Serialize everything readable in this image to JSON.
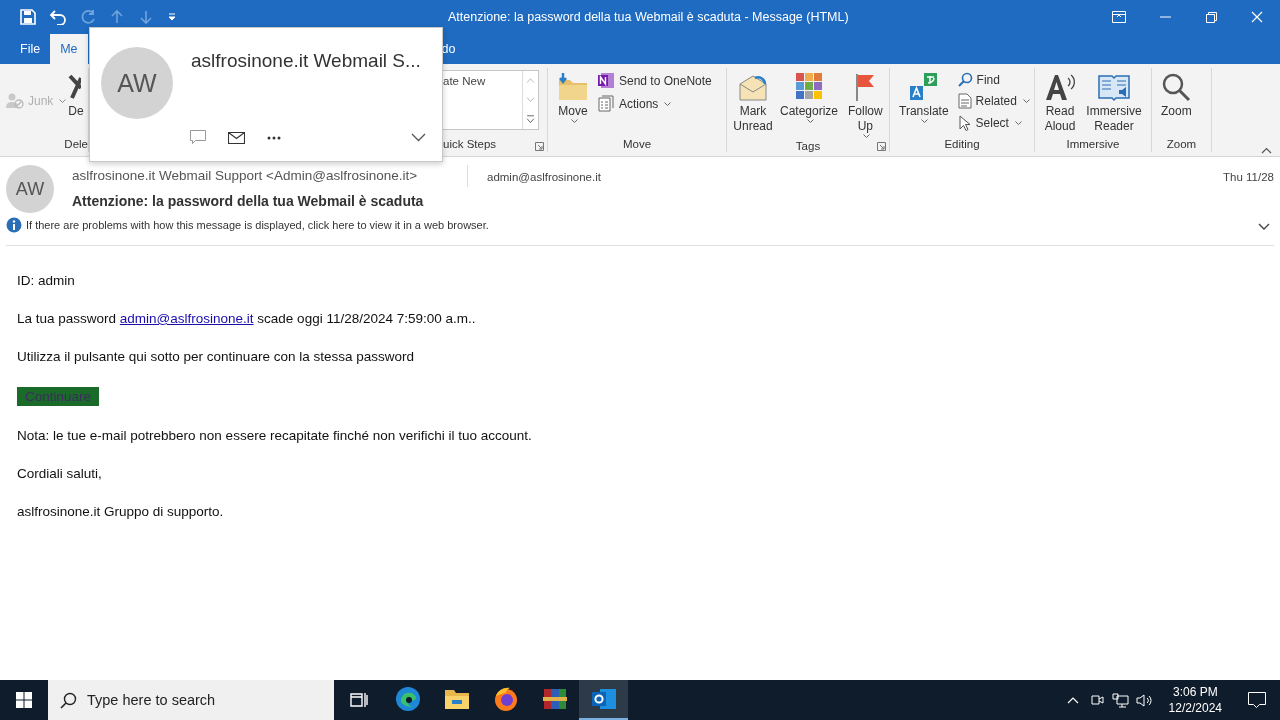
{
  "window": {
    "title": "Attenzione: la password della tua Webmail è scaduta  -  Message (HTML)"
  },
  "tabs": [
    {
      "label": "File",
      "selected": false
    },
    {
      "label": "Me",
      "selected": true
    },
    {
      "label": "do",
      "selected": false
    }
  ],
  "ribbon": {
    "groups": [
      {
        "label": "Dele",
        "items": [
          {
            "label": "Junk",
            "kind": "small",
            "disabled": true,
            "has_menu": true
          },
          {
            "label": "De",
            "kind": "large",
            "disabled": false,
            "has_menu": false
          }
        ]
      },
      {
        "label": "uick Steps",
        "launcher": true,
        "items": [
          {
            "label": "ate New",
            "kind": "gallery",
            "disabled": false,
            "has_menu": false
          }
        ]
      },
      {
        "label": "Move",
        "launcher": false,
        "items": [
          {
            "label": "Move",
            "kind": "large",
            "disabled": false,
            "has_menu": true
          },
          {
            "label": "Send to OneNote",
            "kind": "small",
            "disabled": false,
            "has_menu": false
          },
          {
            "label": "Actions",
            "kind": "small",
            "disabled": false,
            "has_menu": true
          }
        ]
      },
      {
        "label": "Tags",
        "launcher": true,
        "items": [
          {
            "label": "Mark Unread",
            "kind": "large",
            "disabled": false,
            "has_menu": false
          },
          {
            "label": "Categorize",
            "kind": "large",
            "disabled": false,
            "has_menu": true
          },
          {
            "label": "Follow Up",
            "kind": "large",
            "disabled": false,
            "has_menu": true
          }
        ]
      },
      {
        "label": "Editing",
        "launcher": false,
        "items": [
          {
            "label": "Translate",
            "kind": "large",
            "disabled": false,
            "has_menu": true
          },
          {
            "label": "Find",
            "kind": "small",
            "disabled": false,
            "has_menu": false
          },
          {
            "label": "Related",
            "kind": "small",
            "disabled": false,
            "has_menu": true
          },
          {
            "label": "Select",
            "kind": "small",
            "disabled": false,
            "has_menu": true
          }
        ]
      },
      {
        "label": "Immersive",
        "launcher": false,
        "items": [
          {
            "label": "Read Aloud",
            "kind": "large",
            "disabled": false,
            "has_menu": false
          },
          {
            "label": "Immersive Reader",
            "kind": "large",
            "disabled": false,
            "has_menu": false
          }
        ]
      },
      {
        "label": "Zoom",
        "launcher": false,
        "items": [
          {
            "label": "Zoom",
            "kind": "large",
            "disabled": false,
            "has_menu": false
          }
        ]
      }
    ]
  },
  "contact_card": {
    "initials": "AW",
    "name": "aslfrosinone.it Webmail S..."
  },
  "message": {
    "initials": "AW",
    "sender": "aslfrosinone.it Webmail Support <Admin@aslfrosinone.it>",
    "to": "admin@aslfrosinone.it",
    "date": "Thu 11/28",
    "subject": "Attenzione: la password della tua Webmail è scaduta",
    "info": "If there are problems with how this message is displayed, click here to view it in a web browser."
  },
  "body": [
    {
      "kind": "text",
      "text": "ID: admin"
    },
    {
      "kind": "link",
      "before": "La tua password ",
      "link": "admin@aslfrosinone.it",
      "after": "  scade oggi 11/28/2024 7:59:00 a.m.."
    },
    {
      "kind": "text",
      "text": "Utilizza il pulsante qui sotto per continuare con la stessa password"
    },
    {
      "kind": "button",
      "label": "Continuare"
    },
    {
      "kind": "text",
      "text": "Nota: le tue e-mail potrebbero non essere recapitate finché non verifichi il tuo account."
    },
    {
      "kind": "text",
      "text": "Cordiali saluti,"
    },
    {
      "kind": "text",
      "text": "aslfrosinone.it  Gruppo di supporto."
    }
  ],
  "taskbar": {
    "search": {
      "placeholder": "Type here to search"
    },
    "apps": [
      {
        "selected": false
      },
      {
        "selected": false
      },
      {
        "selected": false
      },
      {
        "selected": false
      },
      {
        "selected": true
      }
    ],
    "time": "3:06 PM",
    "date": "12/2/2024"
  }
}
